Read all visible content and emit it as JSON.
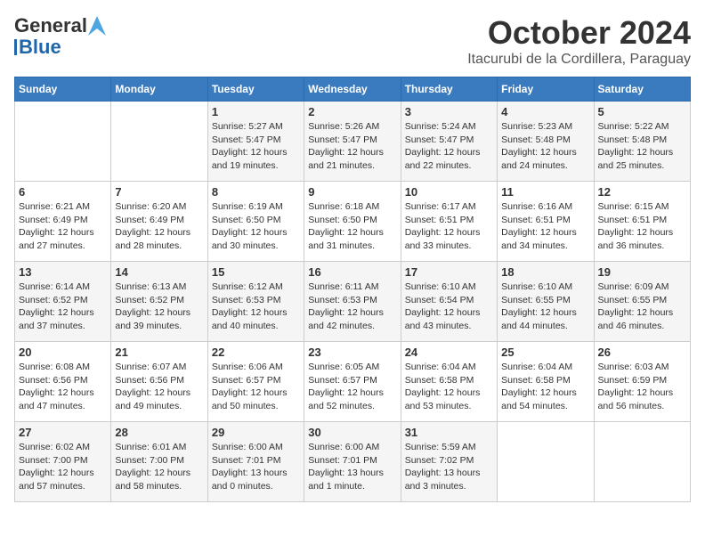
{
  "header": {
    "logo_general": "General",
    "logo_blue": "Blue",
    "title": "October 2024",
    "subtitle": "Itacurubi de la Cordillera, Paraguay"
  },
  "calendar": {
    "days_of_week": [
      "Sunday",
      "Monday",
      "Tuesday",
      "Wednesday",
      "Thursday",
      "Friday",
      "Saturday"
    ],
    "weeks": [
      [
        {
          "day": "",
          "content": ""
        },
        {
          "day": "",
          "content": ""
        },
        {
          "day": "1",
          "content": "Sunrise: 5:27 AM\nSunset: 5:47 PM\nDaylight: 12 hours and 19 minutes."
        },
        {
          "day": "2",
          "content": "Sunrise: 5:26 AM\nSunset: 5:47 PM\nDaylight: 12 hours and 21 minutes."
        },
        {
          "day": "3",
          "content": "Sunrise: 5:24 AM\nSunset: 5:47 PM\nDaylight: 12 hours and 22 minutes."
        },
        {
          "day": "4",
          "content": "Sunrise: 5:23 AM\nSunset: 5:48 PM\nDaylight: 12 hours and 24 minutes."
        },
        {
          "day": "5",
          "content": "Sunrise: 5:22 AM\nSunset: 5:48 PM\nDaylight: 12 hours and 25 minutes."
        }
      ],
      [
        {
          "day": "6",
          "content": "Sunrise: 6:21 AM\nSunset: 6:49 PM\nDaylight: 12 hours and 27 minutes."
        },
        {
          "day": "7",
          "content": "Sunrise: 6:20 AM\nSunset: 6:49 PM\nDaylight: 12 hours and 28 minutes."
        },
        {
          "day": "8",
          "content": "Sunrise: 6:19 AM\nSunset: 6:50 PM\nDaylight: 12 hours and 30 minutes."
        },
        {
          "day": "9",
          "content": "Sunrise: 6:18 AM\nSunset: 6:50 PM\nDaylight: 12 hours and 31 minutes."
        },
        {
          "day": "10",
          "content": "Sunrise: 6:17 AM\nSunset: 6:51 PM\nDaylight: 12 hours and 33 minutes."
        },
        {
          "day": "11",
          "content": "Sunrise: 6:16 AM\nSunset: 6:51 PM\nDaylight: 12 hours and 34 minutes."
        },
        {
          "day": "12",
          "content": "Sunrise: 6:15 AM\nSunset: 6:51 PM\nDaylight: 12 hours and 36 minutes."
        }
      ],
      [
        {
          "day": "13",
          "content": "Sunrise: 6:14 AM\nSunset: 6:52 PM\nDaylight: 12 hours and 37 minutes."
        },
        {
          "day": "14",
          "content": "Sunrise: 6:13 AM\nSunset: 6:52 PM\nDaylight: 12 hours and 39 minutes."
        },
        {
          "day": "15",
          "content": "Sunrise: 6:12 AM\nSunset: 6:53 PM\nDaylight: 12 hours and 40 minutes."
        },
        {
          "day": "16",
          "content": "Sunrise: 6:11 AM\nSunset: 6:53 PM\nDaylight: 12 hours and 42 minutes."
        },
        {
          "day": "17",
          "content": "Sunrise: 6:10 AM\nSunset: 6:54 PM\nDaylight: 12 hours and 43 minutes."
        },
        {
          "day": "18",
          "content": "Sunrise: 6:10 AM\nSunset: 6:55 PM\nDaylight: 12 hours and 44 minutes."
        },
        {
          "day": "19",
          "content": "Sunrise: 6:09 AM\nSunset: 6:55 PM\nDaylight: 12 hours and 46 minutes."
        }
      ],
      [
        {
          "day": "20",
          "content": "Sunrise: 6:08 AM\nSunset: 6:56 PM\nDaylight: 12 hours and 47 minutes."
        },
        {
          "day": "21",
          "content": "Sunrise: 6:07 AM\nSunset: 6:56 PM\nDaylight: 12 hours and 49 minutes."
        },
        {
          "day": "22",
          "content": "Sunrise: 6:06 AM\nSunset: 6:57 PM\nDaylight: 12 hours and 50 minutes."
        },
        {
          "day": "23",
          "content": "Sunrise: 6:05 AM\nSunset: 6:57 PM\nDaylight: 12 hours and 52 minutes."
        },
        {
          "day": "24",
          "content": "Sunrise: 6:04 AM\nSunset: 6:58 PM\nDaylight: 12 hours and 53 minutes."
        },
        {
          "day": "25",
          "content": "Sunrise: 6:04 AM\nSunset: 6:58 PM\nDaylight: 12 hours and 54 minutes."
        },
        {
          "day": "26",
          "content": "Sunrise: 6:03 AM\nSunset: 6:59 PM\nDaylight: 12 hours and 56 minutes."
        }
      ],
      [
        {
          "day": "27",
          "content": "Sunrise: 6:02 AM\nSunset: 7:00 PM\nDaylight: 12 hours and 57 minutes."
        },
        {
          "day": "28",
          "content": "Sunrise: 6:01 AM\nSunset: 7:00 PM\nDaylight: 12 hours and 58 minutes."
        },
        {
          "day": "29",
          "content": "Sunrise: 6:00 AM\nSunset: 7:01 PM\nDaylight: 13 hours and 0 minutes."
        },
        {
          "day": "30",
          "content": "Sunrise: 6:00 AM\nSunset: 7:01 PM\nDaylight: 13 hours and 1 minute."
        },
        {
          "day": "31",
          "content": "Sunrise: 5:59 AM\nSunset: 7:02 PM\nDaylight: 13 hours and 3 minutes."
        },
        {
          "day": "",
          "content": ""
        },
        {
          "day": "",
          "content": ""
        }
      ]
    ]
  }
}
